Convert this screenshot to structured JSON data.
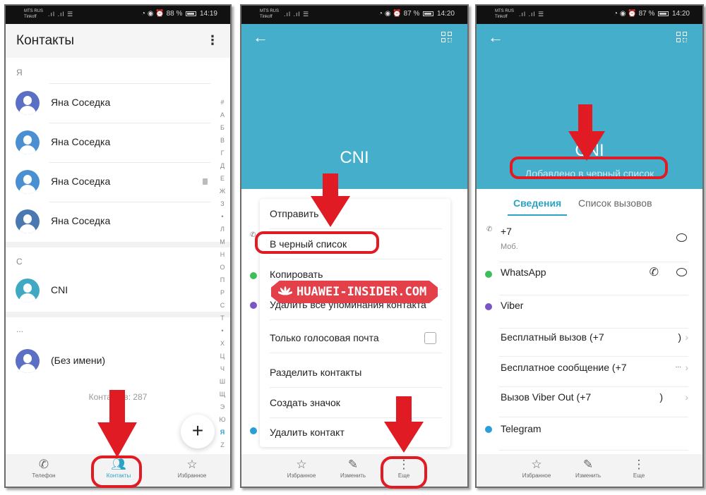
{
  "panels": [
    {
      "status": {
        "carrier1": "MTS RUS",
        "carrier2": "Tinkoff",
        "battery": "88 %",
        "time": "14:19"
      },
      "title": "Контакты",
      "more_icon": "kebab-menu-icon",
      "sections": [
        {
          "letter": "Я",
          "contacts": [
            "Яна Соседка",
            "Яна Соседка",
            "Яна Соседка",
            "Яна Соседка"
          ]
        },
        {
          "letter": "C",
          "contacts": [
            "CNI"
          ]
        },
        {
          "letter": "...",
          "contacts": [
            "(Без имени)"
          ]
        }
      ],
      "index_letters": [
        "#",
        "А",
        "Б",
        "В",
        "Г",
        "Д",
        "Е",
        "Ж",
        "З",
        "•",
        "Л",
        "М",
        "Н",
        "О",
        "П",
        "Р",
        "С",
        "Т",
        "•",
        "Х",
        "Ц",
        "Ч",
        "Ш",
        "Щ",
        "Э",
        "Ю",
        "Я",
        "Z"
      ],
      "active_index": "Я",
      "contact_count": "Контактов: 287",
      "fab_label": "+",
      "nav": [
        {
          "label": "Телефон",
          "icon": "phone-icon"
        },
        {
          "label": "Контакты",
          "icon": "contacts-icon",
          "active": true
        },
        {
          "label": "Избранное",
          "icon": "star-icon"
        }
      ]
    },
    {
      "status": {
        "carrier1": "MTS RUS",
        "carrier2": "Tinkoff",
        "battery": "87 %",
        "time": "14:20"
      },
      "contact_name": "CNI",
      "menu": [
        "Отправить",
        "В черный список",
        "Копировать",
        "Удалить все упоминания контакта",
        "Только голосовая почта",
        "Разделить контакты",
        "Создать значок",
        "Удалить контакт"
      ],
      "voicemail_checked": false,
      "bottom_actions": [
        {
          "label": "Избранное",
          "icon": "star-icon"
        },
        {
          "label": "Изменить",
          "icon": "edit-icon"
        },
        {
          "label": "Еще",
          "icon": "more-icon"
        }
      ]
    },
    {
      "status": {
        "carrier1": "MTS RUS",
        "carrier2": "Tinkoff",
        "battery": "87 %",
        "time": "14:20"
      },
      "contact_name": "CNI",
      "blacklist_status": "Добавлено в черный список",
      "tabs": [
        "Сведения",
        "Список вызовов"
      ],
      "phone": {
        "number": "+7",
        "type": "Моб."
      },
      "apps": {
        "whatsapp": "WhatsApp",
        "viber": "Viber",
        "viber_items": [
          {
            "label": "Бесплатный вызов (+7",
            "suffix": ")"
          },
          {
            "label": "Бесплатное сообщение (+7",
            "suffix": "..."
          },
          {
            "label": "Вызов Viber Out (+7",
            "suffix": ")"
          }
        ],
        "telegram": "Telegram"
      },
      "bottom_actions": [
        {
          "label": "Избранное",
          "icon": "star-icon"
        },
        {
          "label": "Изменить",
          "icon": "edit-icon"
        },
        {
          "label": "Еще",
          "icon": "more-icon"
        }
      ]
    }
  ],
  "watermark": "HUAWEI-INSIDER.COM",
  "colors": {
    "accent": "#2ba3c5",
    "header": "#45aecb",
    "annotation": "#e11b24",
    "watermark": "#e3404a"
  }
}
